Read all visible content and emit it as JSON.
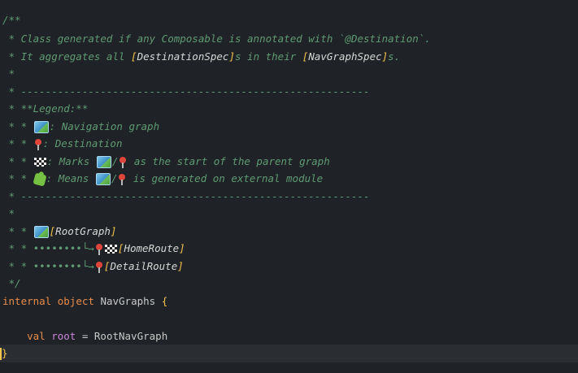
{
  "editor": {
    "lines": [
      {
        "text": "/**"
      },
      {
        "text": " * Class generated if any Composable is annotated with `@Destination`."
      },
      {
        "pre": " * It aggregates all ",
        "b1": "[",
        "ref1": "DestinationSpec",
        "b2": "]",
        "mid": "s in their ",
        "b3": "[",
        "ref2": "NavGraphSpec",
        "b4": "]",
        "post": "s."
      },
      {
        "text": " *"
      },
      {
        "text": " * ---------------------------------------------------------"
      },
      {
        "text": " * **Legend:**"
      },
      {
        "pre": " * * ",
        "post": ": Navigation graph"
      },
      {
        "pre": " * * ",
        "post": ": Destination"
      },
      {
        "pre": " * * ",
        "mid": ": Marks ",
        "slash": "/",
        "post": " as the start of the parent graph"
      },
      {
        "pre": " * * ",
        "mid": ": Means ",
        "slash": "/",
        "post": " is generated on external module"
      },
      {
        "text": " * ---------------------------------------------------------"
      },
      {
        "text": " *"
      },
      {
        "pre": " * * ",
        "b1": "[",
        "ref": "RootGraph",
        "b2": "]"
      },
      {
        "pre": " * * ••••••••",
        "arrow": "└→",
        "b1": "[",
        "ref": "HomeRoute",
        "b2": "]"
      },
      {
        "pre": " * * ••••••••",
        "arrow": "└→",
        "b1": "[",
        "ref": "DetailRoute",
        "b2": "]"
      },
      {
        "text": " */"
      }
    ],
    "code": {
      "kw1": "internal",
      "kw2": "object",
      "name": "NavGraphs",
      "open": "{",
      "indent": "    ",
      "kw3": "val",
      "var": "root",
      "eq": " = ",
      "value": "RootNavGraph",
      "close": "}"
    },
    "icons": {
      "map": "world-map-icon",
      "pin": "round-pushpin-icon",
      "flag": "checkered-flag-icon",
      "puzzle": "puzzle-piece-icon"
    }
  }
}
